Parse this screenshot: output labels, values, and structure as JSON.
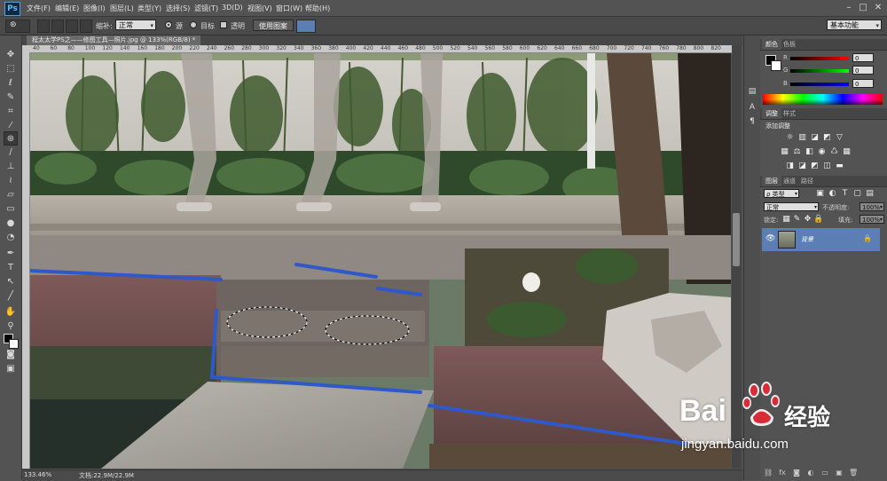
{
  "app": {
    "logo": "Ps",
    "icon": "photoshop-logo"
  },
  "menubar": {
    "items": [
      "文件(F)",
      "编辑(E)",
      "图像(I)",
      "图层(L)",
      "类型(Y)",
      "选择(S)",
      "滤镜(T)",
      "3D(D)",
      "视图(V)",
      "窗口(W)",
      "帮助(H)"
    ],
    "window_controls": [
      "–",
      "□",
      "✕"
    ]
  },
  "options": {
    "feather_label": "缩补:",
    "feather_value": "正常",
    "source_label": "源",
    "target_label": "目标",
    "transparent_label": "透明",
    "use_pattern_button": "使用图案",
    "workspace": "基本功能"
  },
  "document": {
    "tab_title": "程太太学PS之——修图工具—照片.jpg @ 133%(RGB/8) *",
    "ruler_ticks": [
      "40",
      "60",
      "80",
      "100",
      "120",
      "140",
      "160",
      "180",
      "200",
      "220",
      "240",
      "260",
      "280",
      "300",
      "320",
      "340",
      "360",
      "380",
      "400",
      "420",
      "440",
      "460",
      "480",
      "500",
      "520",
      "540",
      "560",
      "580",
      "600",
      "620",
      "640",
      "660",
      "680",
      "700",
      "720",
      "740",
      "760",
      "780",
      "800",
      "820"
    ],
    "zoom": "133.46%",
    "doc_size": "文档:22.9M/22.9M"
  },
  "panels": {
    "color_tabs": [
      "颜色",
      "色板"
    ],
    "rgb": [
      {
        "label": "R",
        "value": "0"
      },
      {
        "label": "G",
        "value": "0"
      },
      {
        "label": "B",
        "value": "0"
      }
    ],
    "adjust_tabs": [
      "调整",
      "样式"
    ],
    "adjust_title": "添加调整",
    "layers_tabs": [
      "图层",
      "通道",
      "路径"
    ],
    "kind_filter": "ρ 类型",
    "blend_mode": "正常",
    "opacity_label": "不透明度:",
    "opacity_value": "100%",
    "lock_label": "锁定:",
    "fill_label": "填充:",
    "fill_value": "100%",
    "layer_name": "背景"
  },
  "watermark": {
    "brand": "Bai",
    "brand2": "经验",
    "url": "jingyan.baidu.com"
  },
  "colors": {
    "accent": "#5b7fb5",
    "ui_bg": "#535353",
    "wm_red": "#d7232f"
  }
}
